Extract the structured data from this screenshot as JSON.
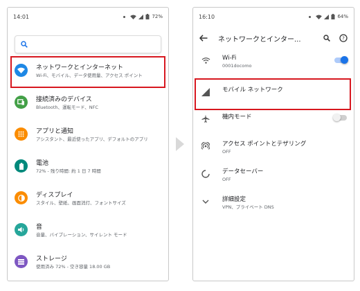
{
  "colors": {
    "highlight": "#d7171f",
    "accent": "#1a73e8",
    "icon_network": "#1e88e5",
    "icon_devices": "#43a047",
    "icon_apps": "#fb8c00",
    "icon_battery": "#00897b",
    "icon_display": "#fb8c00",
    "icon_sound": "#26a69a",
    "icon_storage": "#7e57c2"
  },
  "left": {
    "status": {
      "time": "14:01",
      "battery": "72%"
    },
    "search": {
      "icon": "search-icon"
    },
    "items": [
      {
        "title": "ネットワークとインターネット",
        "subtitle": "Wi-Fi、モバイル、データ使用量、アクセス ポイント",
        "icon": "wifi-icon"
      },
      {
        "title": "接続済みのデバイス",
        "subtitle": "Bluetooth、運転モード、NFC",
        "icon": "devices-icon"
      },
      {
        "title": "アプリと通知",
        "subtitle": "アシスタント、最近使ったアプリ、デフォルトのアプリ",
        "icon": "apps-icon"
      },
      {
        "title": "電池",
        "subtitle": "72% - 残り時間: 約 1 日 7 時間",
        "icon": "battery-icon"
      },
      {
        "title": "ディスプレイ",
        "subtitle": "スタイル、壁紙、画面消灯、フォントサイズ",
        "icon": "display-icon"
      },
      {
        "title": "音",
        "subtitle": "音量、バイブレーション、サイレント モード",
        "icon": "volume-icon"
      },
      {
        "title": "ストレージ",
        "subtitle": "使用済み 72% - 空き容量 18.00 GB",
        "icon": "storage-icon"
      }
    ]
  },
  "right": {
    "status": {
      "time": "16:10",
      "battery": "64%"
    },
    "appbar": {
      "title": "ネットワークとインター...",
      "back": "back-arrow-icon",
      "search": "search-icon",
      "help": "help-icon"
    },
    "items": [
      {
        "title": "Wi-Fi",
        "subtitle": "0001docomo",
        "icon": "wifi-icon",
        "toggle": true
      },
      {
        "title": "モバイル ネットワーク",
        "subtitle": "",
        "icon": "signal-icon"
      },
      {
        "title": "機内モード",
        "subtitle": "",
        "icon": "airplane-icon",
        "toggle": false
      },
      {
        "title": "アクセス ポイントとテザリング",
        "subtitle": "OFF",
        "icon": "hotspot-icon"
      },
      {
        "title": "データセーバー",
        "subtitle": "OFF",
        "icon": "data-saver-icon"
      },
      {
        "title": "詳細設定",
        "subtitle": "VPN、プライベート DNS",
        "icon": "chevron-down-icon"
      }
    ]
  }
}
